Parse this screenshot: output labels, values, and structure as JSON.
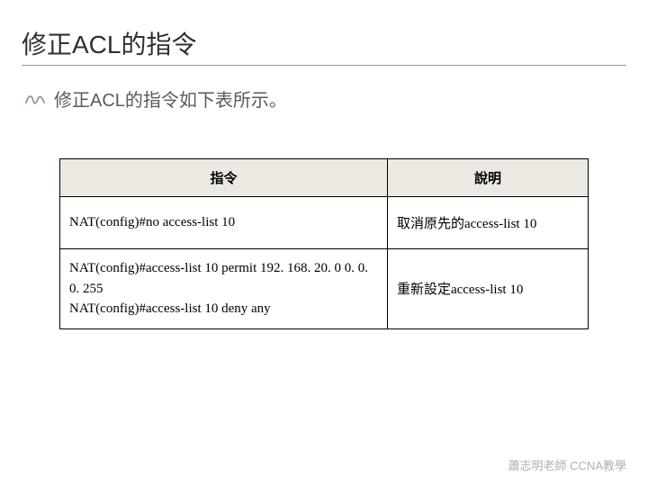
{
  "title": "修正ACL的指令",
  "bullet": "修正ACL的指令如下表所示。",
  "table": {
    "head": {
      "cmd": "指令",
      "desc": "說明"
    },
    "rows": [
      {
        "cmd": "NAT(config)#no access-list 10",
        "desc": "取消原先的access-list 10"
      },
      {
        "cmd": "NAT(config)#access-list 10 permit 192. 168. 20. 0 0. 0. 0. 255\nNAT(config)#access-list 10 deny any",
        "desc": "重新設定access-list 10"
      }
    ]
  },
  "footer": "蕭志明老師 CCNA教學"
}
